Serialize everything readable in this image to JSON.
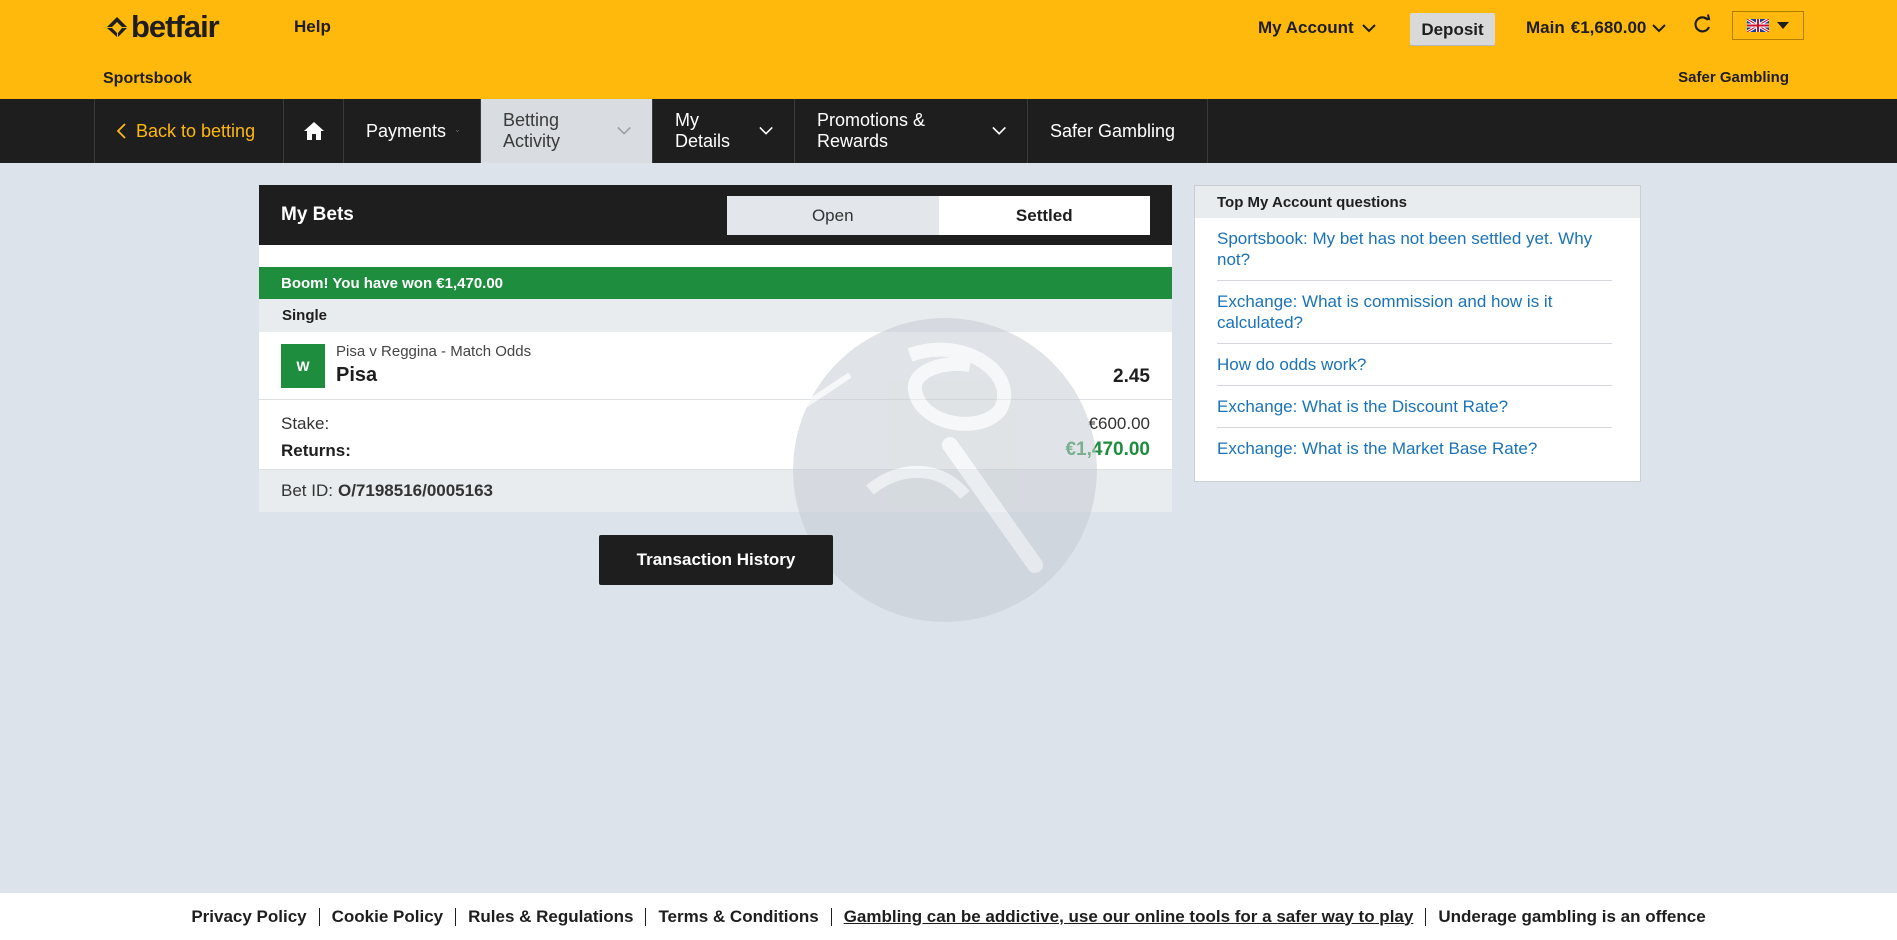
{
  "header": {
    "logo_text": "betfair",
    "help": "Help",
    "sportsbook": "Sportsbook",
    "safer_gambling": "Safer Gambling",
    "my_account": "My Account",
    "deposit": "Deposit",
    "balance_label": "Main",
    "balance_value": "€1,680.00"
  },
  "nav": {
    "back": "Back to betting",
    "payments": "Payments",
    "betting_activity": "Betting Activity",
    "my_details": "My Details",
    "promotions": "Promotions & Rewards",
    "safer_gambling": "Safer Gambling"
  },
  "bets": {
    "title": "My Bets",
    "tab_open": "Open",
    "tab_settled": "Settled",
    "won_banner": "Boom! You have won €1,470.00",
    "bet_type": "Single",
    "result_badge": "W",
    "market": "Pisa v Reggina - Match Odds",
    "selection": "Pisa",
    "odds": "2.45",
    "stake_label": "Stake:",
    "stake_value": "€600.00",
    "returns_label": "Returns:",
    "returns_value": "€1,470.00",
    "bet_id_label": "Bet ID:",
    "bet_id_value": "O/7198516/0005163",
    "transaction_history": "Transaction History"
  },
  "faq": {
    "title": "Top My Account questions",
    "items": [
      "Sportsbook: My bet has not been settled yet. Why not?",
      "Exchange: What is commission and how is it calculated?",
      "How do odds work?",
      "Exchange: What is the Discount Rate?",
      "Exchange: What is the Market Base Rate?"
    ]
  },
  "footer": {
    "links": [
      "Privacy Policy",
      "Cookie Policy",
      "Rules & Regulations",
      "Terms & Conditions",
      "Gambling can be addictive, use our online tools for a safer way to play",
      "Underage gambling is an offence"
    ]
  },
  "colors": {
    "brand_yellow": "#ffb80c",
    "nav_dark": "#1e1e1e",
    "win_green": "#1e8e3e",
    "link_blue": "#1a73b8"
  },
  "icons": [
    "betfair-logo-icon",
    "chevron-down-icon",
    "refresh-icon",
    "uk-flag-icon",
    "chevron-left-icon",
    "home-icon"
  ]
}
